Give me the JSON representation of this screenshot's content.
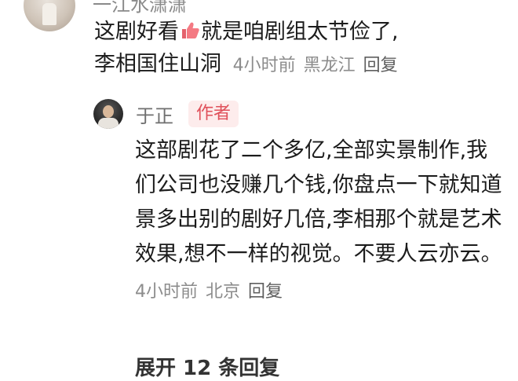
{
  "top_comment": {
    "author": "一江水潇潇",
    "text_line1": "这剧好看",
    "thumb_icon": "thumbs-up-icon",
    "text_line1_rest": "就是咱剧组太节俭了,",
    "text_line2": "李相国住山洞",
    "time": "4小时前",
    "location": "黑龙江",
    "reply_label": "回复"
  },
  "reply": {
    "author": "于正",
    "badge": "作者",
    "text": "这部剧花了二个多亿,全部实景制作,我们公司也没赚几个钱,你盘点一下就知道景多出别的剧好几倍,李相那个就是艺术效果,想不一样的视觉。不要人云亦云。",
    "time": "4小时前",
    "location": "北京",
    "reply_label": "回复"
  },
  "expand_label": "展开 12 条回复",
  "colors": {
    "badge_bg": "#fdecec",
    "badge_text": "#e0505a",
    "meta_text": "#8c8c8c"
  }
}
